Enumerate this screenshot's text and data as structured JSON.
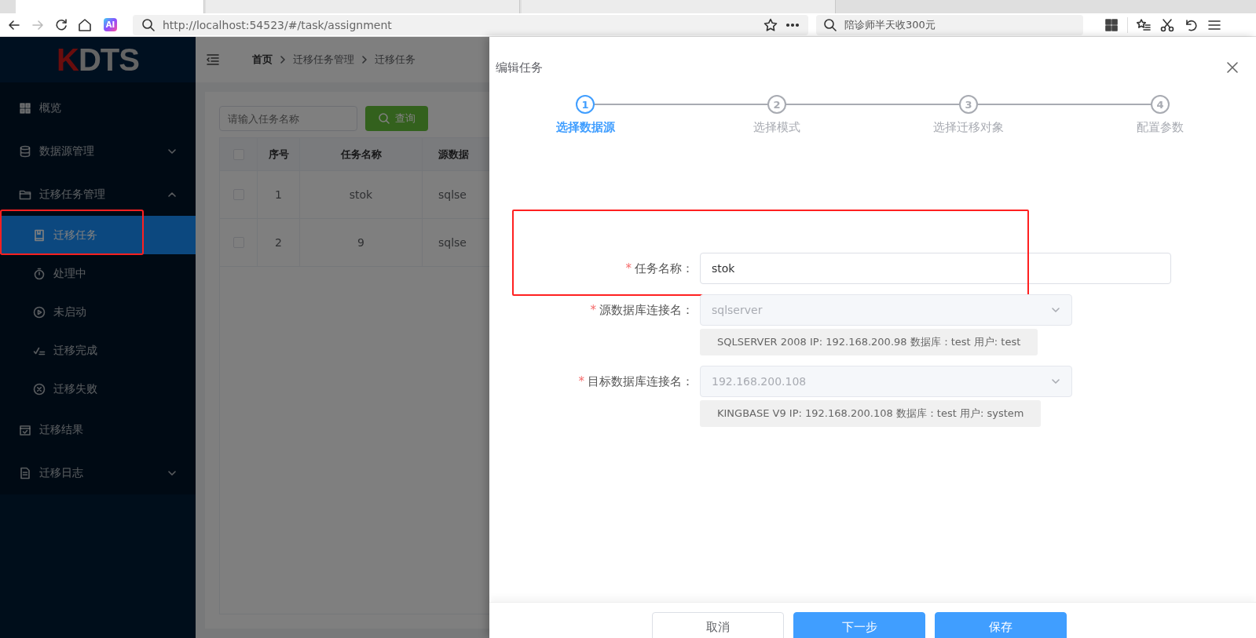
{
  "browser": {
    "tabs": [
      {
        "selected": true
      },
      {
        "selected": false
      },
      {
        "selected": false
      }
    ],
    "back_enabled": true,
    "forward_enabled": false,
    "ai_badge": "AI",
    "url": "http://localhost:54523/#/task/assignment",
    "search": {
      "placeholder": "陪诊师半天收300元"
    }
  },
  "sidebar": {
    "logo_mark": "K",
    "logo_text": "DTS",
    "items": [
      {
        "label": "概览",
        "selected": false
      },
      {
        "label": "数据源管理",
        "selected": false,
        "expanded": false
      },
      {
        "label": "迁移任务管理",
        "selected": false,
        "expanded": true,
        "children": [
          {
            "label": "迁移任务",
            "selected": true,
            "highlighted": true
          },
          {
            "label": "处理中",
            "selected": false
          },
          {
            "label": "未启动",
            "selected": false
          },
          {
            "label": "迁移完成",
            "selected": false
          },
          {
            "label": "迁移失败",
            "selected": false
          }
        ]
      },
      {
        "label": "迁移结果",
        "selected": false
      },
      {
        "label": "迁移日志",
        "selected": false,
        "expanded": false
      }
    ]
  },
  "breadcrumb": [
    "首页",
    "迁移任务管理",
    "迁移任务"
  ],
  "search": {
    "placeholder": "请输入任务名称",
    "button": "查询"
  },
  "table": {
    "all_checked": false,
    "columns": [
      "序号",
      "任务名称",
      "源数据"
    ],
    "rows": [
      {
        "checked": false,
        "cells": [
          "1",
          "stok",
          "sqlse"
        ]
      },
      {
        "checked": false,
        "cells": [
          "2",
          "9",
          "sqlse"
        ]
      }
    ]
  },
  "drawer": {
    "title": "编辑任务",
    "steps": [
      {
        "number": "1",
        "label": "选择数据源",
        "selected": true
      },
      {
        "number": "2",
        "label": "选择模式",
        "selected": false
      },
      {
        "number": "3",
        "label": "选择迁移对象",
        "selected": false
      },
      {
        "number": "4",
        "label": "配置参数",
        "selected": false
      }
    ],
    "fields": [
      {
        "kind": "input",
        "label": "任务名称：",
        "required_mark": "*",
        "value": "stok",
        "disabled": false,
        "highlighted": true
      },
      {
        "kind": "select",
        "label": "源数据库连接名：",
        "required_mark": "*",
        "value": "sqlserver",
        "disabled": true,
        "info": "SQLSERVER 2008 IP: 192.168.200.98 数据库：test 用户: test"
      },
      {
        "kind": "select",
        "label": "目标数据库连接名：",
        "required_mark": "*",
        "value": "192.168.200.108",
        "disabled": true,
        "info": "KINGBASE V9 IP: 192.168.200.108 数据库：test 用户: system"
      }
    ],
    "buttons": [
      {
        "label": "取消",
        "kind": "default"
      },
      {
        "label": "下一步",
        "kind": "primary"
      },
      {
        "label": "保存",
        "kind": "primary"
      }
    ]
  }
}
